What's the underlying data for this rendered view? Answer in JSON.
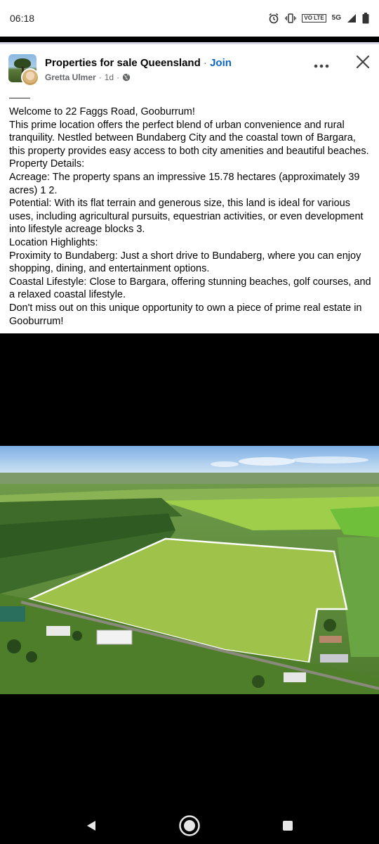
{
  "status_bar": {
    "time": "06:18",
    "icons": [
      "alarm-icon",
      "vibrate-icon",
      "volte-icon",
      "5g-icon",
      "signal-icon",
      "battery-icon"
    ],
    "volte_text": "VO LTE",
    "network_text": "5G"
  },
  "post": {
    "group_name": "Properties for sale Queensland",
    "separator": " · ",
    "join_label": "Join",
    "author": "Gretta Ulmer",
    "time_ago": "1d",
    "meta_sep": "·",
    "paragraphs": [
      "Welcome to 22 Faggs Road, Gooburrum!",
      "This prime location offers the perfect blend of urban convenience and rural tranquility. Nestled between Bundaberg City and the coastal town of Bargara, this property provides easy access to both city amenities and beautiful beaches.",
      "Property Details:",
      "Acreage: The property spans an impressive 15.78 hectares (approximately 39 acres) 1 2.",
      "Potential: With its flat terrain and generous size, this land is ideal for various uses, including agricultural pursuits, equestrian activities, or even development into lifestyle acreage blocks 3.",
      "Location Highlights:",
      "Proximity to Bundaberg: Just a short drive to Bundaberg, where you can enjoy shopping, dining, and entertainment options.",
      "Coastal Lifestyle: Close to Bargara, offering stunning beaches, golf courses, and a relaxed coastal lifestyle.",
      "Don't miss out on this unique opportunity to own a piece of prime real estate in Gooburrum!"
    ]
  },
  "media": {
    "image_kind": "aerial-photo-farmland"
  },
  "nav_bar": {
    "buttons": [
      "back-icon",
      "home-icon",
      "recents-icon"
    ]
  },
  "colors": {
    "link": "#0a66c2",
    "text": "#050505",
    "muted": "#65676b",
    "background": "#ffffff",
    "media_background": "#000000"
  }
}
